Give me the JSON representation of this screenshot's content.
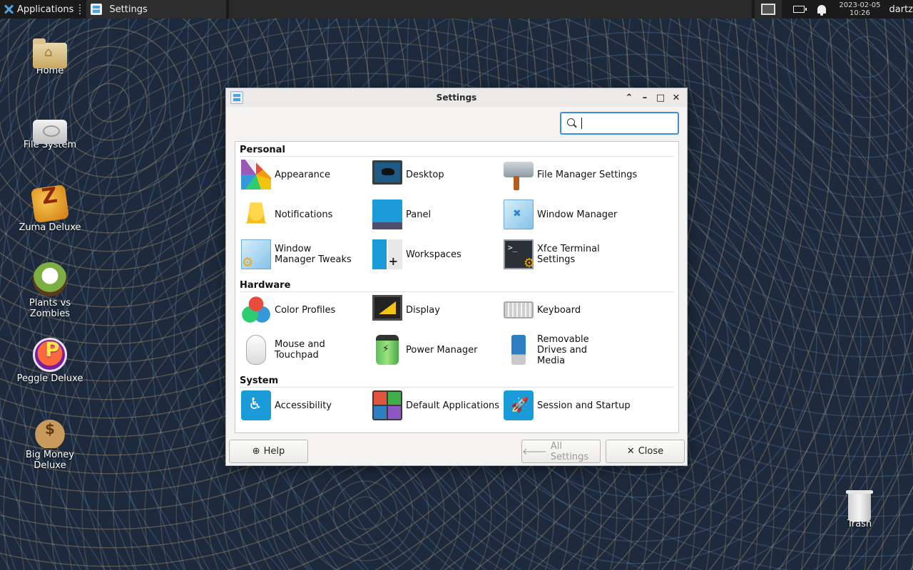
{
  "topbar": {
    "applications_label": "Applications",
    "task_label": "Settings",
    "clock_date": "2023-02-05",
    "clock_time": "10:26",
    "user": "dartz"
  },
  "desktop_icons": [
    {
      "label": "Home",
      "icon": "home-folder-icon"
    },
    {
      "label": "File System",
      "icon": "drive-icon"
    },
    {
      "label": "Zuma Deluxe",
      "icon": "zuma-icon"
    },
    {
      "label": "Plants vs Zombies",
      "icon": "pvz-icon"
    },
    {
      "label": "Peggle Deluxe",
      "icon": "peggle-icon"
    },
    {
      "label": "Big Money Deluxe",
      "icon": "money-bag-icon"
    },
    {
      "label": "Trash",
      "icon": "trash-icon"
    }
  ],
  "window": {
    "title": "Settings",
    "search": {
      "value": "",
      "placeholder": ""
    },
    "sections": [
      {
        "title": "Personal",
        "items": [
          {
            "label": "Appearance",
            "icon": "appearance-icon"
          },
          {
            "label": "Desktop",
            "icon": "desktop-icon"
          },
          {
            "label": "File Manager Settings",
            "icon": "file-manager-icon"
          },
          {
            "label": "Notifications",
            "icon": "notifications-icon"
          },
          {
            "label": "Panel",
            "icon": "panel-icon"
          },
          {
            "label": "Window Manager",
            "icon": "window-manager-icon"
          },
          {
            "label": "Window Manager Tweaks",
            "icon": "window-manager-tweaks-icon"
          },
          {
            "label": "Workspaces",
            "icon": "workspaces-icon"
          },
          {
            "label": "Xfce Terminal Settings",
            "icon": "terminal-icon"
          }
        ]
      },
      {
        "title": "Hardware",
        "items": [
          {
            "label": "Color Profiles",
            "icon": "color-profiles-icon"
          },
          {
            "label": "Display",
            "icon": "display-icon"
          },
          {
            "label": "Keyboard",
            "icon": "keyboard-icon"
          },
          {
            "label": "Mouse and Touchpad",
            "icon": "mouse-icon"
          },
          {
            "label": "Power Manager",
            "icon": "battery-icon"
          },
          {
            "label": "Removable Drives and Media",
            "icon": "usb-drive-icon"
          }
        ]
      },
      {
        "title": "System",
        "items": [
          {
            "label": "Accessibility",
            "icon": "accessibility-icon"
          },
          {
            "label": "Default Applications",
            "icon": "default-applications-icon"
          },
          {
            "label": "Session and Startup",
            "icon": "rocket-icon"
          }
        ]
      }
    ],
    "buttons": {
      "help": "Help",
      "all_settings": "All Settings",
      "close": "Close"
    }
  },
  "colors": {
    "accent": "#3b8fd9",
    "panel_bg": "#1a1a1a",
    "window_bg": "#f4f3f1"
  }
}
